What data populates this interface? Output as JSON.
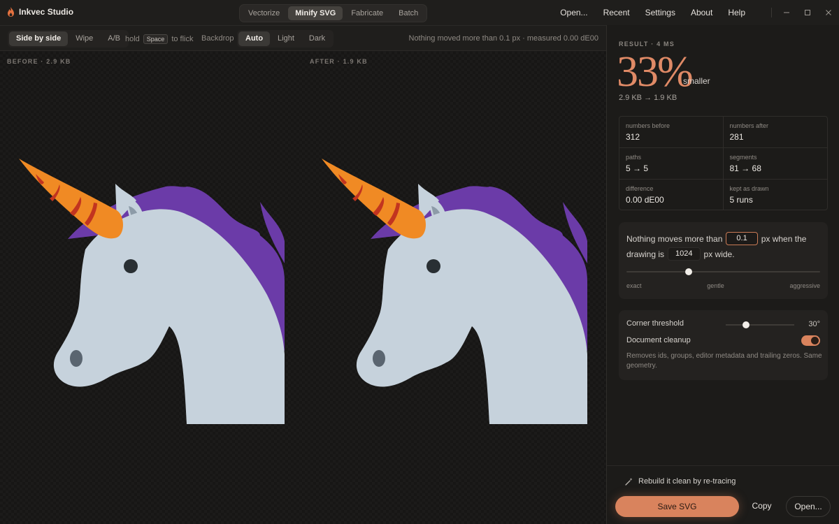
{
  "app": {
    "title": "Inkvec Studio"
  },
  "modes": [
    {
      "label": "Vectorize",
      "active": false
    },
    {
      "label": "Minify SVG",
      "active": true
    },
    {
      "label": "Fabricate",
      "active": false
    },
    {
      "label": "Batch",
      "active": false
    }
  ],
  "menu": [
    "Open...",
    "Recent",
    "Settings",
    "About",
    "Help"
  ],
  "toolbar": {
    "compare_modes": [
      {
        "label": "Side by side",
        "active": true
      },
      {
        "label": "Wipe",
        "active": false
      },
      {
        "label": "A/B",
        "active": false
      }
    ],
    "hint_prefix": "hold",
    "hint_key": "Space",
    "hint_suffix": "to flick",
    "backdrop_label": "Backdrop",
    "backdrops": [
      {
        "label": "Auto",
        "active": true
      },
      {
        "label": "Light",
        "active": false
      },
      {
        "label": "Dark",
        "active": false
      }
    ],
    "status": "Nothing moved more than 0.1 px · measured 0.00 dE00"
  },
  "canvas": {
    "before_label": "BEFORE · 2.9 KB",
    "after_label": "AFTER · 1.9 KB"
  },
  "result": {
    "label": "RESULT · 4 MS",
    "percent": "33%",
    "smaller": "smaller",
    "size_change": "2.9 KB → 1.9 KB",
    "stats": [
      {
        "label": "numbers before",
        "value": "312"
      },
      {
        "label": "numbers after",
        "value": "281"
      },
      {
        "label": "paths",
        "value": "5 → 5"
      },
      {
        "label": "segments",
        "value": "81 → 68"
      },
      {
        "label": "difference",
        "value": "0.00 dE00"
      },
      {
        "label": "kept as drawn",
        "value": "5 runs"
      }
    ]
  },
  "tolerance": {
    "text1": "Nothing moves more than",
    "value": "0.1",
    "text2": "px when the",
    "text3": "drawing is",
    "width": "1024",
    "text4": "px wide.",
    "slider_level": 0.32,
    "scale": [
      "exact",
      "gentle",
      "aggressive"
    ]
  },
  "options": {
    "corner_label": "Corner threshold",
    "corner_value": "30°",
    "corner_level": 0.3,
    "cleanup_label": "Document cleanup",
    "cleanup_on": true,
    "cleanup_desc": "Removes ids, groups, editor metadata and trailing zeros. Same geometry."
  },
  "actions": {
    "retrace": "Rebuild it clean by re-tracing",
    "save": "Save SVG",
    "copy": "Copy",
    "open": "Open..."
  },
  "colors": {
    "accent": "#d9835d",
    "unicorn_body": "#c6d2dc",
    "unicorn_mane": "#6b3ba8",
    "horn": "#f08a24",
    "horn_stripe": "#c2341f"
  },
  "icons": {
    "logo": "flame-icon",
    "retrace": "wand-icon"
  }
}
